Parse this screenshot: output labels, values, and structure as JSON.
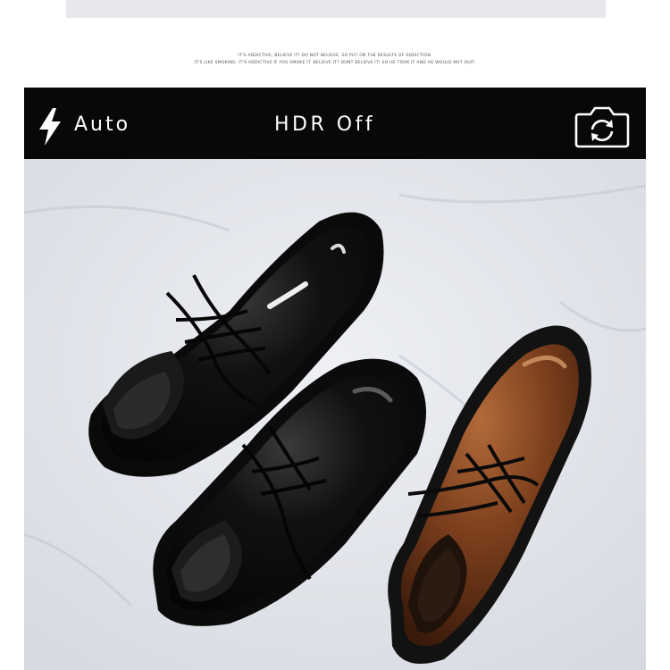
{
  "taglines": [
    "IT'S ADDICTIVE, BELIEVE IT! DO NOT BELIEVE, SO PUT ON THE RESULTS OF ADDICTION.",
    "IT'S LIKE SMOKING. IT'S ADDICTIVE IF YOU SMOKE IT. BELIEVE IT? DONT BELIEVE IT! SO HE TOOK IT AND HE WOULD NOT QUIT."
  ],
  "camera_bar": {
    "flash_mode": "Auto",
    "hdr_status": "HDR Off",
    "icons": [
      "flash-icon",
      "switch-camera-icon"
    ]
  },
  "photo": {
    "subject": "",
    "colors": {
      "background": "#e4e6ec",
      "black_leather": "#0b0b0b",
      "brown_leather": "#7a3e1c",
      "sole": "#141414"
    }
  }
}
